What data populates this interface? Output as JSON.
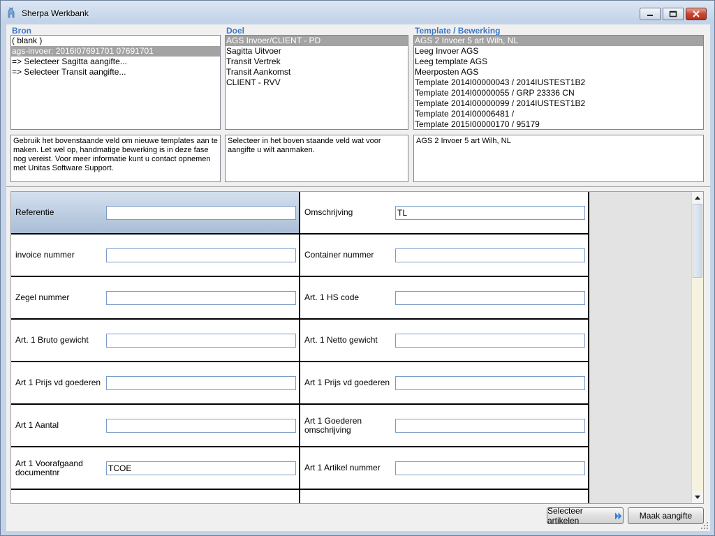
{
  "window": {
    "title": "Sherpa Werkbank"
  },
  "bron": {
    "label": "Bron",
    "items": [
      {
        "text": "( blank )",
        "selected": false
      },
      {
        "text": "ags-invoer: 2016I07691701 07691701",
        "selected": true
      },
      {
        "text": "=> Selecteer Sagitta aangifte...",
        "selected": false
      },
      {
        "text": "=> Selecteer Transit aangifte...",
        "selected": false
      }
    ],
    "description": "Gebruik het bovenstaande veld om nieuwe templates aan te maken. Let wel op, handmatige bewerking is in deze fase nog vereist. Voor meer informatie kunt u contact opnemen met Unitas Software Support."
  },
  "doel": {
    "label": "Doel",
    "items": [
      {
        "text": "AGS Invoer/CLIENT - PD",
        "selected": true
      },
      {
        "text": "Sagitta Uitvoer",
        "selected": false
      },
      {
        "text": "Transit Vertrek",
        "selected": false
      },
      {
        "text": "Transit Aankomst",
        "selected": false
      },
      {
        "text": "CLIENT - RVV",
        "selected": false
      }
    ],
    "description": "Selecteer in het boven staande veld wat voor aangifte u wilt aanmaken."
  },
  "template": {
    "label": "Template / Bewerking",
    "items": [
      {
        "text": "AGS 2 Invoer 5 art Wilh, NL",
        "selected": true
      },
      {
        "text": "Leeg Invoer AGS",
        "selected": false
      },
      {
        "text": "Leeg template AGS",
        "selected": false
      },
      {
        "text": "Meerposten AGS",
        "selected": false
      },
      {
        "text": "Template 2014I00000043 / 2014IUSTEST1B2",
        "selected": false
      },
      {
        "text": "Template 2014I00000055 / GRP 23336 CN",
        "selected": false
      },
      {
        "text": "Template 2014I00000099 / 2014IUSTEST1B2",
        "selected": false
      },
      {
        "text": "Template 2014I00006481 /",
        "selected": false
      },
      {
        "text": "Template 2015I00000170 / 95179",
        "selected": false
      }
    ],
    "description": "AGS 2 Invoer 5 art Wilh, NL"
  },
  "fields": {
    "left": [
      {
        "label": "Referentie",
        "value": ""
      },
      {
        "label": "invoice nummer",
        "value": ""
      },
      {
        "label": "Zegel nummer",
        "value": ""
      },
      {
        "label": "Art. 1 Bruto gewicht",
        "value": ""
      },
      {
        "label": "Art 1 Prijs vd goederen",
        "value": ""
      },
      {
        "label": "Art 1 Aantal",
        "value": ""
      },
      {
        "label": "Art 1 Voorafgaand documentnr",
        "value": "TCOE"
      }
    ],
    "right": [
      {
        "label": "Omschrijving",
        "value": "TL"
      },
      {
        "label": "Container nummer",
        "value": ""
      },
      {
        "label": "Art. 1 HS code",
        "value": ""
      },
      {
        "label": "Art. 1 Netto gewicht",
        "value": ""
      },
      {
        "label": "Art 1 Prijs vd goederen",
        "value": ""
      },
      {
        "label": "Art 1 Goederen omschrijving",
        "value": ""
      },
      {
        "label": "Art 1 Artikel nummer",
        "value": ""
      }
    ]
  },
  "buttons": {
    "select_articles": "Selecteer artikelen",
    "make_declaration": "Maak aangifte"
  },
  "colors": {
    "section_label": "#3b78c7",
    "list_selected": "#a3a3a3",
    "active_cell": "#b7c8dd"
  }
}
